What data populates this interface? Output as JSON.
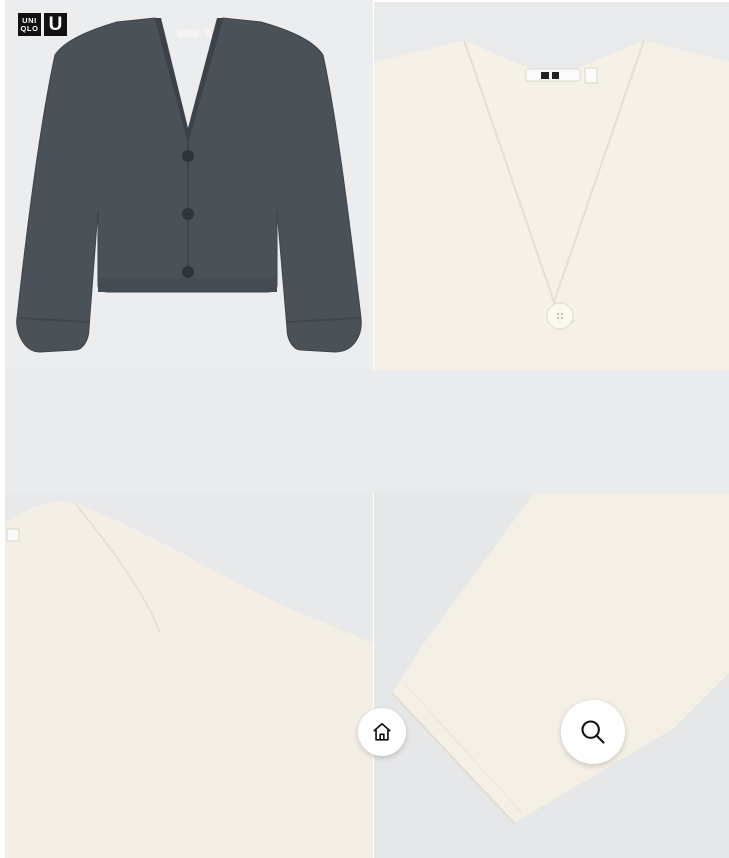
{
  "brand": {
    "logo_left_lines": [
      "UNI",
      "QLO"
    ],
    "logo_right": "U"
  },
  "gallery": {
    "images": [
      {
        "name": "dark-gray-cardigan-front",
        "color": "#4b5257"
      },
      {
        "name": "off-white-cardigan-collar-closeup",
        "color": "#f5f0e6"
      },
      {
        "name": "off-white-cardigan-shoulder-closeup",
        "color": "#f4efe5"
      },
      {
        "name": "off-white-cardigan-sleeve-closeup",
        "color": "#f5f0e6"
      }
    ]
  },
  "fab": {
    "home_icon": "home-icon",
    "search_icon": "search-icon"
  },
  "colors": {
    "background": "#eaebed",
    "garment_dark": "#4b5257",
    "garment_light": "#f5f0e6",
    "button_bg": "#ffffff"
  }
}
